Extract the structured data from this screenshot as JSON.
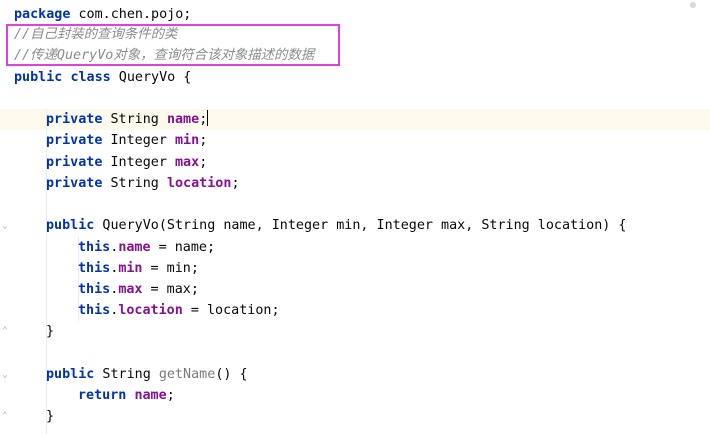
{
  "code": {
    "line1": {
      "kw": "package",
      "text": " com.chen.pojo;"
    },
    "line2": {
      "comment": "//自己封装的查询条件的类"
    },
    "line3": {
      "comment": "//传递QueryVo对象，查询符合该对象描述的数据"
    },
    "line4": {
      "kw1": "public",
      "kw2": "class",
      "text": " QueryVo {"
    },
    "line6": {
      "kw": "private",
      "type": " String ",
      "field": "name",
      "end": ";"
    },
    "line7": {
      "kw": "private",
      "type": " Integer ",
      "field": "min",
      "end": ";"
    },
    "line8": {
      "kw": "private",
      "type": " Integer ",
      "field": "max",
      "end": ";"
    },
    "line9": {
      "kw": "private",
      "type": " String ",
      "field": "location",
      "end": ";"
    },
    "line11": {
      "kw": "public",
      "text": " QueryVo(String name, Integer min, Integer max, String location) {"
    },
    "line12": {
      "kw": "this",
      "dot": ".",
      "field": "name",
      "rest": " = name;"
    },
    "line13": {
      "kw": "this",
      "dot": ".",
      "field": "min",
      "rest": " = min;"
    },
    "line14": {
      "kw": "this",
      "dot": ".",
      "field": "max",
      "rest": " = max;"
    },
    "line15": {
      "kw": "this",
      "dot": ".",
      "field": "location",
      "rest": " = location;"
    },
    "line16": {
      "text": "}"
    },
    "line18": {
      "kw": "public",
      "type": " String ",
      "method": "getName",
      "rest": "() {"
    },
    "line19": {
      "kw": "return",
      "space": " ",
      "field": "name",
      "end": ";"
    },
    "line20": {
      "text": "}"
    }
  },
  "colors": {
    "keyword": "#0033b3",
    "field": "#871094",
    "comment": "#8c8c8c",
    "highlight_box": "#e040e0",
    "current_line": "#fcfaed"
  }
}
